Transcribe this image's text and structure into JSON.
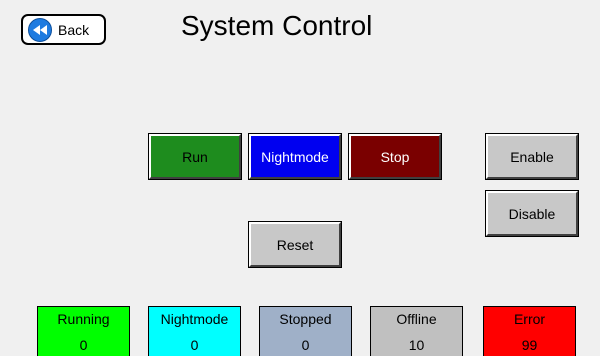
{
  "header": {
    "back_label": "Back",
    "title": "System Control"
  },
  "controls": {
    "run": "Run",
    "nightmode": "Nightmode",
    "stop": "Stop",
    "enable": "Enable",
    "disable": "Disable",
    "reset": "Reset"
  },
  "status": [
    {
      "label": "Running",
      "value": "0",
      "color": "#00ff00"
    },
    {
      "label": "Nightmode",
      "value": "0",
      "color": "#00ffff"
    },
    {
      "label": "Stopped",
      "value": "0",
      "color": "#9fb0c8"
    },
    {
      "label": "Offline",
      "value": "10",
      "color": "#c0c0c0"
    },
    {
      "label": "Error",
      "value": "99",
      "color": "#ff0000"
    }
  ]
}
